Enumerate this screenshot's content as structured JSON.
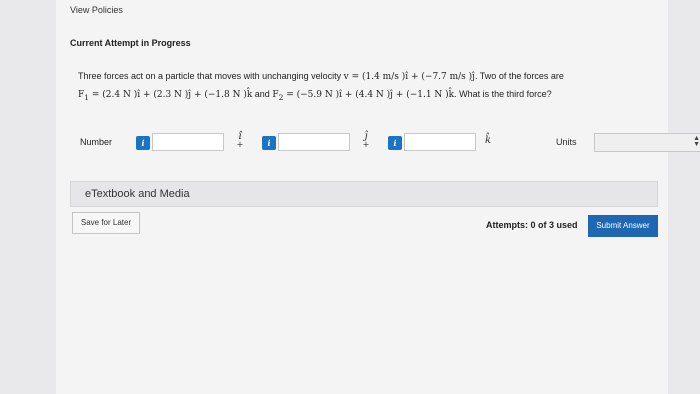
{
  "header": {
    "view_policies": "View Policies",
    "attempt_heading": "Current Attempt in Progress"
  },
  "problem": {
    "line1_intro": "Three forces act on a particle that moves with unchanging velocity ",
    "v_label": "v",
    "v_eq": " = ",
    "v_x": "(1.4 m/s )î + ",
    "v_y": "(−7.7 m/s )ĵ",
    "line1_tail": ". Two of the forces are",
    "f1_label": "F",
    "f1_sub": "1",
    "f1_expr": " = (2.4 N )î + (2.3 N )ĵ + (−1.8 N )k̂",
    "and": " and ",
    "f2_label": "F",
    "f2_sub": "2",
    "f2_expr": " = (−5.9 N )î + (4.4 N )ĵ + (−1.1 N )k̂",
    "question": ". What is the third force?"
  },
  "answer": {
    "number_label": "Number",
    "info_glyph": "i",
    "i_hat": "î",
    "j_hat": "ĵ",
    "k_hat": "k̂",
    "plus": "+",
    "units_label": "Units",
    "inputs": [
      "",
      "",
      ""
    ],
    "units_selected": ""
  },
  "etextbook": {
    "label": "eTextbook and Media"
  },
  "footer": {
    "save_later": "Save for Later",
    "attempts": "Attempts: 0 of 3 used",
    "submit": "Submit Answer"
  },
  "colors": {
    "info_blue": "#1a73c4",
    "submit_blue": "#1f66b3"
  }
}
